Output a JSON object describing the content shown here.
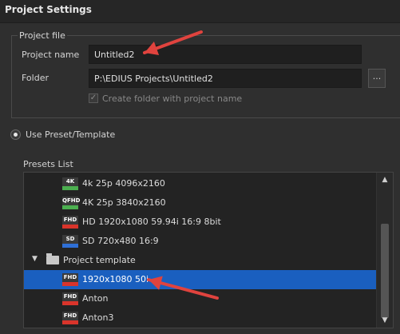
{
  "window": {
    "title": "Project Settings"
  },
  "project_file": {
    "legend": "Project file",
    "name_label": "Project name",
    "name_value": "Untitled2",
    "folder_label": "Folder",
    "folder_value": "P:\\EDIUS Projects\\Untitled2",
    "browse_label": "...",
    "create_folder_label": "Create folder with project name",
    "create_folder_checked": true
  },
  "preset_option": {
    "label": "Use Preset/Template",
    "selected": true
  },
  "presets": {
    "label": "Presets List",
    "items": [
      {
        "badge": "4K",
        "badge_color": "#4caf50",
        "name": "4k 25p  4096x2160",
        "indent": 1
      },
      {
        "badge": "QFHD",
        "badge_color": "#4caf50",
        "name": "4K 25p 3840x2160",
        "indent": 1
      },
      {
        "badge": "FHD",
        "badge_color": "#d9342b",
        "name": "HD 1920x1080 59.94i 16:9 8bit",
        "indent": 1
      },
      {
        "badge": "SD",
        "badge_color": "#2f6fd6",
        "name": "SD 720x480 16:9",
        "indent": 1
      },
      {
        "badge": "folder",
        "badge_color": "#c8c8c8",
        "name": "Project template",
        "indent": 0,
        "expanded": true
      },
      {
        "badge": "FHD",
        "badge_color": "#d9342b",
        "name": "1920x1080 50i",
        "indent": 1,
        "selected": true
      },
      {
        "badge": "FHD",
        "badge_color": "#d9342b",
        "name": "Anton",
        "indent": 1
      },
      {
        "badge": "FHD",
        "badge_color": "#d9342b",
        "name": "Anton3",
        "indent": 1
      }
    ]
  },
  "annotation_color": "#e0433e"
}
